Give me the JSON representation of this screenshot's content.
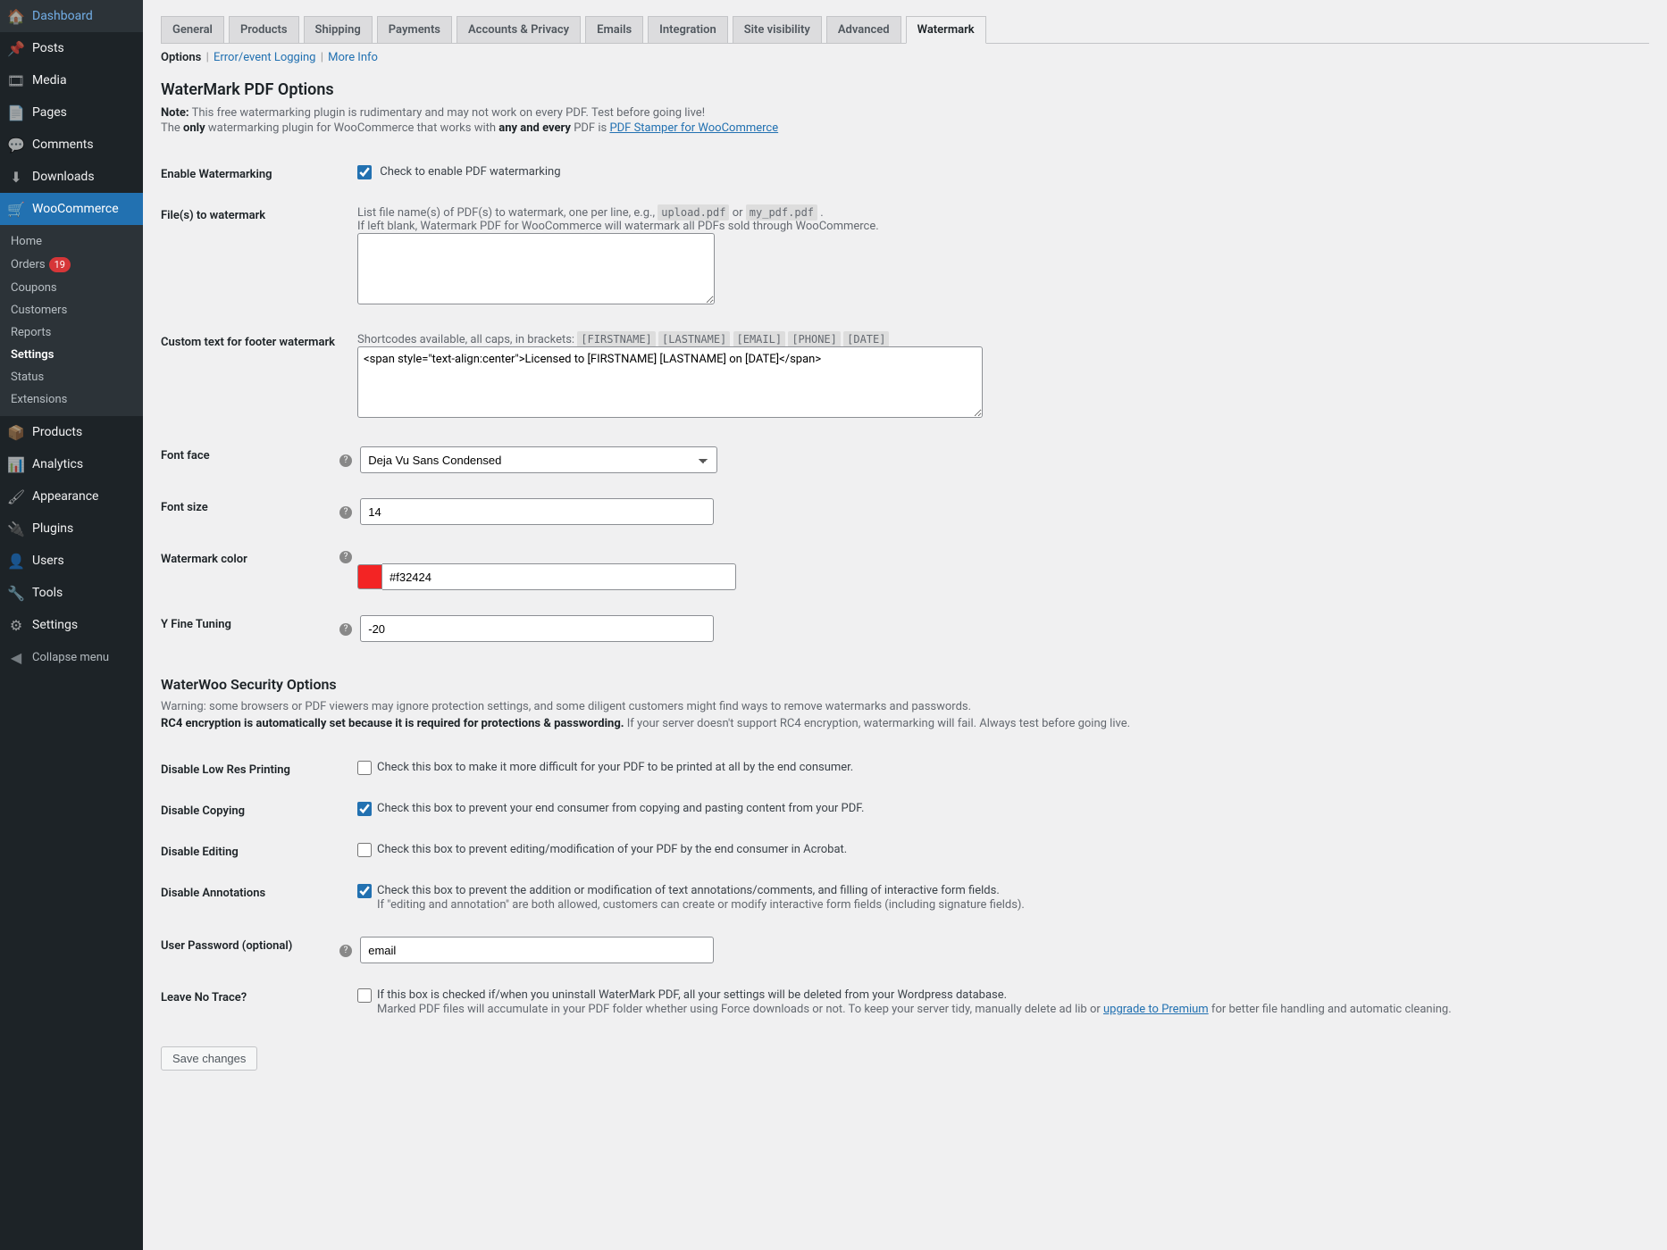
{
  "sidebar": {
    "items": [
      {
        "icon": "🏠",
        "label": "Dashboard"
      },
      {
        "icon": "📌",
        "label": "Posts"
      },
      {
        "icon": "🎞",
        "label": "Media"
      },
      {
        "icon": "📄",
        "label": "Pages"
      },
      {
        "icon": "💬",
        "label": "Comments"
      },
      {
        "icon": "⬇",
        "label": "Downloads"
      }
    ],
    "active": {
      "icon": "🛒",
      "label": "WooCommerce"
    },
    "submenu": [
      {
        "label": "Home"
      },
      {
        "label": "Orders",
        "badge": "19"
      },
      {
        "label": "Coupons"
      },
      {
        "label": "Customers"
      },
      {
        "label": "Reports"
      },
      {
        "label": "Settings",
        "current": true
      },
      {
        "label": "Status"
      },
      {
        "label": "Extensions"
      }
    ],
    "items_after": [
      {
        "icon": "📦",
        "label": "Products"
      },
      {
        "icon": "📊",
        "label": "Analytics"
      },
      {
        "icon": "🖌",
        "label": "Appearance"
      },
      {
        "icon": "🔌",
        "label": "Plugins"
      },
      {
        "icon": "👤",
        "label": "Users"
      },
      {
        "icon": "🔧",
        "label": "Tools"
      },
      {
        "icon": "⚙",
        "label": "Settings"
      }
    ],
    "collapse": {
      "icon": "◀",
      "label": "Collapse menu"
    }
  },
  "tabs": [
    "General",
    "Products",
    "Shipping",
    "Payments",
    "Accounts & Privacy",
    "Emails",
    "Integration",
    "Site visibility",
    "Advanced",
    "Watermark"
  ],
  "active_tab": "Watermark",
  "subnav": {
    "current": "Options",
    "links": [
      "Error/event Logging",
      "More Info"
    ]
  },
  "section1": {
    "title": "WaterMark PDF Options",
    "note_prefix": "Note:",
    "note_text": " This free watermarking plugin is rudimentary and may not work on every PDF. Test before going live!",
    "note2_pre": "The ",
    "note2_only": "only",
    "note2_mid": " watermarking plugin for WooCommerce that works with ",
    "note2_any": "any and every",
    "note2_post": " PDF is ",
    "note2_link": "PDF Stamper for WooCommerce"
  },
  "f": {
    "enable": {
      "label": "Enable Watermarking",
      "desc": "Check to enable PDF watermarking",
      "checked": true
    },
    "files": {
      "label": "File(s) to watermark",
      "d1": "List file name(s) of PDF(s) to watermark, one per line, e.g., ",
      "c1": "upload.pdf",
      "or": "  or  ",
      "c2": "my_pdf.pdf",
      "dot": " .",
      "d2": "If left blank, Watermark PDF for WooCommerce will watermark all PDFs sold through WooCommerce.",
      "value": ""
    },
    "custom": {
      "label": "Custom text for footer watermark",
      "d1": "Shortcodes available, all caps, in brackets: ",
      "codes": [
        "[FIRSTNAME]",
        "[LASTNAME]",
        "[EMAIL]",
        "[PHONE]",
        "[DATE]"
      ],
      "value": "<span style=\"text-align:center\">Licensed to [FIRSTNAME] [LASTNAME] on [DATE]</span>"
    },
    "font": {
      "label": "Font face",
      "value": "Deja Vu Sans Condensed"
    },
    "size": {
      "label": "Font size",
      "value": "14"
    },
    "color": {
      "label": "Watermark color",
      "value": "#f32424"
    },
    "y": {
      "label": "Y Fine Tuning",
      "value": "-20"
    }
  },
  "section2": {
    "title": "WaterWoo Security Options",
    "w1": "Warning: some browsers or PDF viewers may ignore protection settings, and some diligent customers might find ways to remove watermarks and passwords.",
    "w2b": "RC4 encryption is automatically set because it is required for protections & passwording.",
    "w2r": " If your server doesn't support RC4 encryption, watermarking will fail. Always test before going live."
  },
  "g": {
    "lowres": {
      "label": "Disable Low Res Printing",
      "desc": "Check this box to make it more difficult for your PDF to be printed at all by the end consumer.",
      "checked": false
    },
    "copy": {
      "label": "Disable Copying",
      "desc": "Check this box to prevent your end consumer from copying and pasting content from your PDF.",
      "checked": true
    },
    "edit": {
      "label": "Disable Editing",
      "desc": "Check this box to prevent editing/modification of your PDF by the end consumer in Acrobat.",
      "checked": false
    },
    "annot": {
      "label": "Disable Annotations",
      "d1": "Check this box to prevent the addition or modification of text annotations/comments, and filling of interactive form fields.",
      "d2": "If \"editing and annotation\" are both allowed, customers can create or modify interactive form fields (including signature fields).",
      "checked": true
    },
    "pw": {
      "label": "User Password (optional)",
      "value": "email"
    },
    "trace": {
      "label": "Leave No Trace?",
      "d1": "If this box is checked if/when you uninstall WaterMark PDF, all your settings will be deleted from your Wordpress database.",
      "d2a": "Marked PDF files will accumulate in your PDF folder whether using Force downloads or not. To keep your server tidy, manually delete ad lib or ",
      "d2link": "upgrade to Premium",
      "d2b": " for better file handling and automatic cleaning.",
      "checked": false
    }
  },
  "save": "Save changes"
}
